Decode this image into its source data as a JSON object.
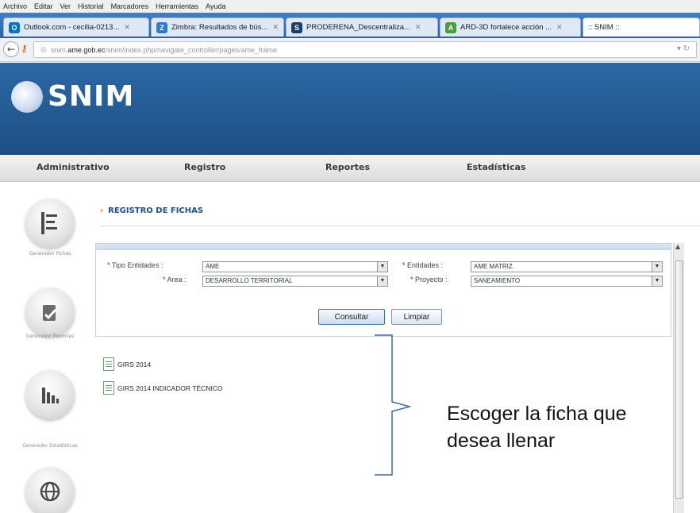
{
  "browser": {
    "menu": [
      "Archivo",
      "Editar",
      "Ver",
      "Historial",
      "Marcadores",
      "Herramientas",
      "Ayuda"
    ],
    "tabs": [
      {
        "title": "Outlook.com - cecilia-0213...",
        "icon": "outlook-icon",
        "color": "#0072c6"
      },
      {
        "title": "Zimbra: Resultados de bús...",
        "icon": "zimbra-icon",
        "color": "#2e7bd0"
      },
      {
        "title": "PRODERENA_Descentraliza...",
        "icon": "proderena-icon",
        "color": "#1d3d6a"
      },
      {
        "title": "ARD-3D fortalece acción ...",
        "icon": "ard-icon",
        "color": "#4a9d3c"
      },
      {
        "title": ":: SNIM ::",
        "icon": "snim-icon",
        "color": "#2c68a5",
        "active": true
      }
    ],
    "url_prefix": "snim.",
    "url_domain": "ame.gob.ec",
    "url_path": "/snim/index.php/navigate_controller/pages/ame_frame"
  },
  "app": {
    "logo_text": "SNIM",
    "nav": [
      "Administrativo",
      "Registro",
      "Reportes",
      "Estadísticas"
    ],
    "sidebar": [
      {
        "label": "Generador Fichas",
        "icon": "forms-icon"
      },
      {
        "label": "Generador Reportes",
        "icon": "reports-icon"
      },
      {
        "label": "Generador Estadísticas",
        "icon": "statistics-icon"
      },
      {
        "label": "",
        "icon": "globe-icon"
      }
    ],
    "page_title": "REGISTRO DE FICHAS",
    "form": {
      "tipo_entidades_label": "Tipo Entidades :",
      "tipo_entidades_value": "AME",
      "entidades_label": "Entidades :",
      "entidades_value": "AME MATRIZ",
      "area_label": "Area :",
      "area_value": "DESARROLLO TERRITORIAL",
      "proyecto_label": "Proyecto :",
      "proyecto_value": "SANEAMIENTO",
      "required_mark": "*",
      "consultar_label": "Consultar",
      "limpiar_label": "Limpiar"
    },
    "fichas": [
      "GIRS 2014",
      "GIRS 2014 INDICADOR TÉCNICO"
    ],
    "annotation": {
      "line1": "Escoger la ficha que",
      "line2": "desea llenar"
    }
  }
}
